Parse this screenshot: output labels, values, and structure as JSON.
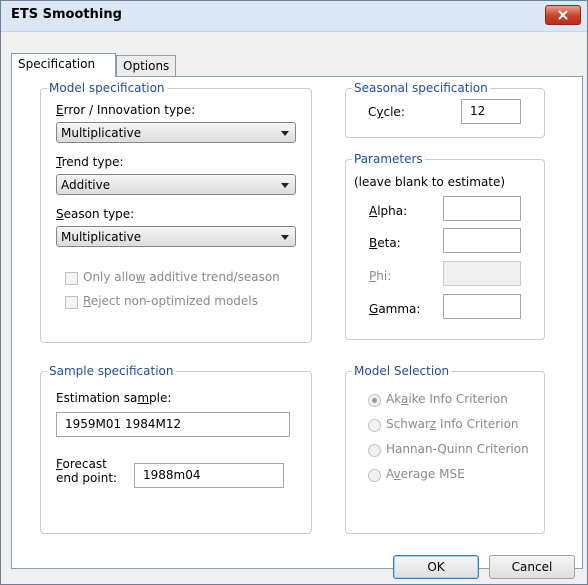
{
  "window": {
    "title": "ETS Smoothing"
  },
  "tabs": [
    {
      "label": "Specification"
    },
    {
      "label": "Options"
    }
  ],
  "model_spec": {
    "legend": "Model specification",
    "error_label": "Error / Innovation type:",
    "error_value": "Multiplicative",
    "trend_label": "Trend type:",
    "trend_value": "Additive",
    "season_label": "Season type:",
    "season_value": "Multiplicative",
    "chk_additive": "Only allow additive trend/season",
    "chk_reject": "Reject non-optimized models"
  },
  "seasonal_spec": {
    "legend": "Seasonal specification",
    "cycle_label": "Cycle:",
    "cycle_value": "12"
  },
  "parameters": {
    "legend": "Parameters",
    "hint": "(leave blank to estimate)",
    "alpha_label": "Alpha:",
    "beta_label": "Beta:",
    "phi_label": "Phi:",
    "gamma_label": "Gamma:"
  },
  "sample_spec": {
    "legend": "Sample specification",
    "estimation_label": "Estimation sample:",
    "estimation_value": "1959M01 1984M12",
    "forecast_label_1": "Forecast",
    "forecast_label_2": "end point:",
    "forecast_value": "1988m04"
  },
  "model_selection": {
    "legend": "Model Selection",
    "options": [
      {
        "label": "Akaike Info Criterion",
        "checked": true
      },
      {
        "label": "Schwarz Info Criterion",
        "checked": false
      },
      {
        "label": "Hannan-Quinn Criterion",
        "checked": false
      },
      {
        "label": "Average MSE",
        "checked": false
      }
    ]
  },
  "buttons": {
    "ok": "OK",
    "cancel": "Cancel"
  },
  "icons": {
    "close": "close-icon"
  }
}
